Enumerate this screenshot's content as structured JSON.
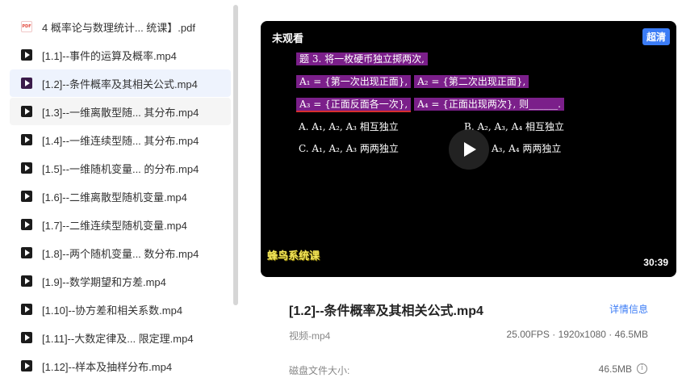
{
  "files": [
    {
      "name": "4 概率论与数理统计...   统课】.pdf",
      "type": "pdf"
    },
    {
      "name": "[1.1]--事件的运算及概率.mp4",
      "type": "video"
    },
    {
      "name": "[1.2]--条件概率及其相关公式.mp4",
      "type": "video",
      "selected": true
    },
    {
      "name": "[1.3]--一维离散型随... 其分布.mp4",
      "type": "video",
      "hover": true
    },
    {
      "name": "[1.4]--一维连续型随... 其分布.mp4",
      "type": "video"
    },
    {
      "name": "[1.5]--一维随机变量... 的分布.mp4",
      "type": "video"
    },
    {
      "name": "[1.6]--二维离散型随机变量.mp4",
      "type": "video"
    },
    {
      "name": "[1.7]--二维连续型随机变量.mp4",
      "type": "video"
    },
    {
      "name": "[1.8]--两个随机变量... 数分布.mp4",
      "type": "video"
    },
    {
      "name": "[1.9]--数学期望和方差.mp4",
      "type": "video"
    },
    {
      "name": "[1.10]--协方差和相关系数.mp4",
      "type": "video"
    },
    {
      "name": "[1.11]--大数定律及... 限定理.mp4",
      "type": "video"
    },
    {
      "name": "[1.12]--样本及抽样分布.mp4",
      "type": "video"
    }
  ],
  "pdf_icon_label": "PDF",
  "player": {
    "status": "未观看",
    "quality": "超清",
    "duration": "30:39",
    "frame": {
      "line1": "题 3. 将一枚硬币独立掷两次,",
      "line2a": "A₁ = {第一次出现正面},",
      "line2b": "A₂ = {第二次出现正面},",
      "line3a": "A₃ = {正面反面各一次},",
      "line3b": "A₄ = {正面出现两次}, 则______.",
      "optA": "A. A₁, A₂, A₃ 相互独立",
      "optB": "B. A₂, A₃, A₄ 相互独立",
      "optC": "C. A₁, A₂, A₃ 两两独立",
      "optD": "A₃, A₄ 两两独立",
      "watermark": "蜂鸟系统课"
    }
  },
  "details": {
    "title": "[1.2]--条件概率及其相关公式.mp4",
    "link": "详情信息",
    "type": "视频-mp4",
    "specs": "25.00FPS · 1920x1080 · 46.5MB",
    "disk_label": "磁盘文件大小:",
    "disk_value": "46.5MB",
    "info_icon": "i"
  }
}
